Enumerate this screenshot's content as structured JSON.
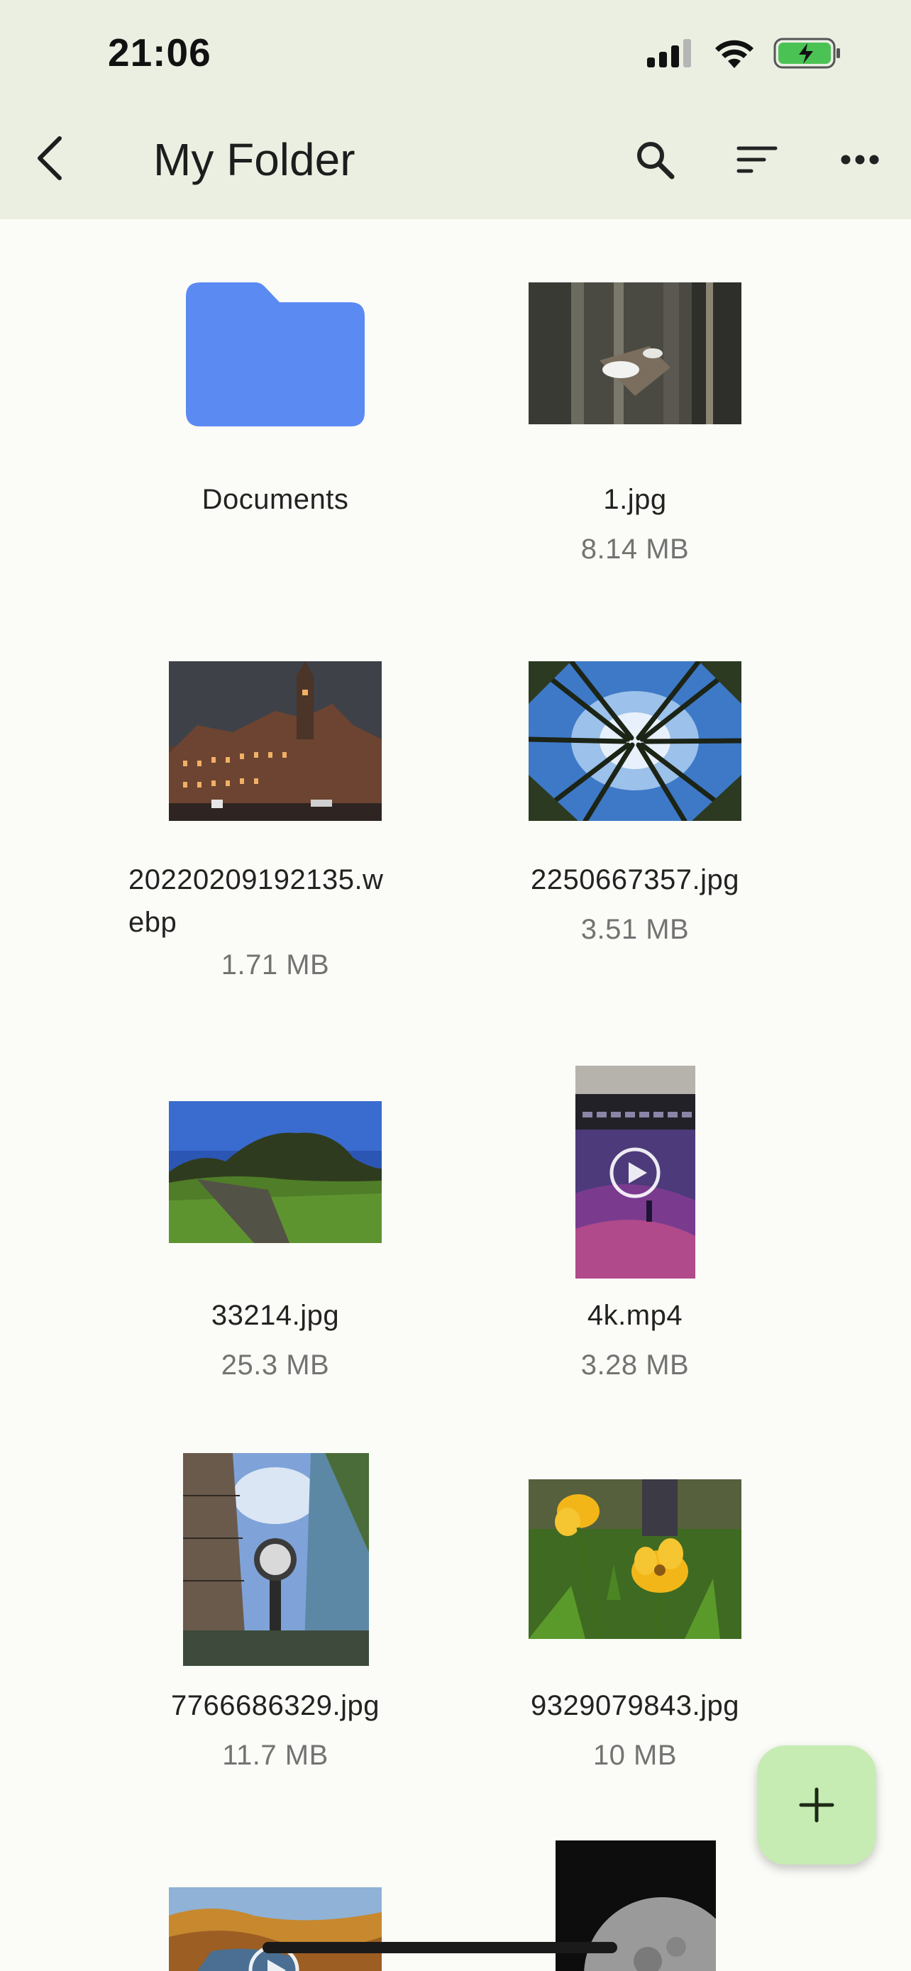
{
  "status_bar": {
    "time": "21:06"
  },
  "header": {
    "title": "My Folder",
    "back_icon": "chevron-left-icon",
    "actions": [
      "search-icon",
      "sort-icon",
      "more-horizontal-icon"
    ]
  },
  "items": [
    {
      "name": "Documents",
      "size": "",
      "kind": "folder"
    },
    {
      "name": "1.jpg",
      "size": "8.14 MB",
      "kind": "image"
    },
    {
      "name": "20220209192135.w",
      "name_line2": "ebp",
      "size": "1.71 MB",
      "kind": "image"
    },
    {
      "name": "2250667357.jpg",
      "size": "3.51 MB",
      "kind": "image"
    },
    {
      "name": "33214.jpg",
      "size": "25.3 MB",
      "kind": "image"
    },
    {
      "name": "4k.mp4",
      "size": "3.28 MB",
      "kind": "video"
    },
    {
      "name": "7766686329.jpg",
      "size": "11.7 MB",
      "kind": "image"
    },
    {
      "name": "9329079843.jpg",
      "size": "10 MB",
      "kind": "image"
    }
  ],
  "fab": {
    "icon": "plus-icon"
  },
  "colors": {
    "header_bg": "#eaefe2",
    "page_bg": "#fbfcf7",
    "folder": "#5b8af3",
    "fab": "#c7ecb3"
  }
}
